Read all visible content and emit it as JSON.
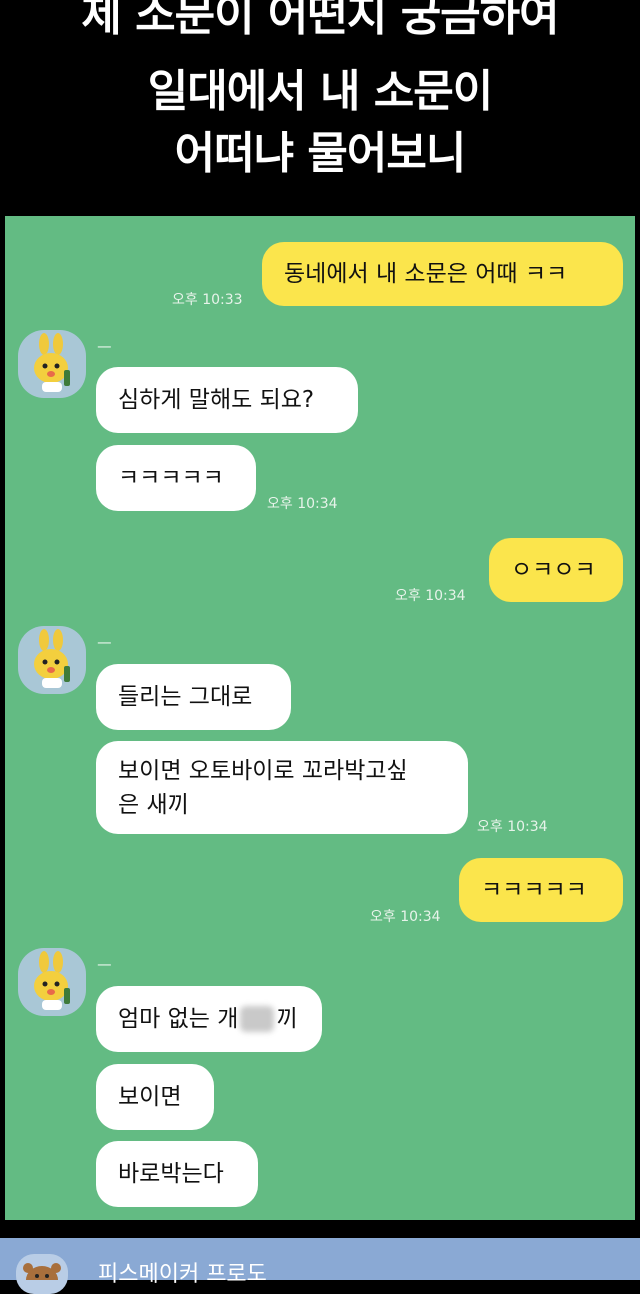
{
  "header": {
    "line1": "제 소문이 어떤지 궁금하여",
    "line2": "일대에서 내 소문이",
    "line3": "어떠냐 물어보니"
  },
  "chat": {
    "sender_name": "ㅡ",
    "messages": [
      {
        "text": "동네에서 내 소문은 어때 ㅋㅋ",
        "time": "오후 10:33"
      },
      {
        "text": "심하게 말해도 되요?"
      },
      {
        "text": "ㅋㅋㅋㅋㅋ",
        "time": "오후 10:34"
      },
      {
        "text": "ㅇㅋㅇㅋ",
        "time": "오후 10:34"
      },
      {
        "text": "들리는 그대로"
      },
      {
        "text_line1": "보이면 오토바이로 꼬라박고싶",
        "text_line2": "은 새끼",
        "time": "오후 10:34"
      },
      {
        "text": "ㅋㅋㅋㅋㅋ",
        "time": "오후 10:34"
      },
      {
        "text_before": "엄마 없는 개",
        "text_after": "끼"
      },
      {
        "text": "보이면"
      },
      {
        "text": "바로박는다"
      }
    ]
  },
  "footer": {
    "name": "피스메이커 프로도"
  },
  "colors": {
    "chat_bg": "#63bb83",
    "my_bubble": "#fbe54c",
    "their_bubble": "#ffffff"
  }
}
